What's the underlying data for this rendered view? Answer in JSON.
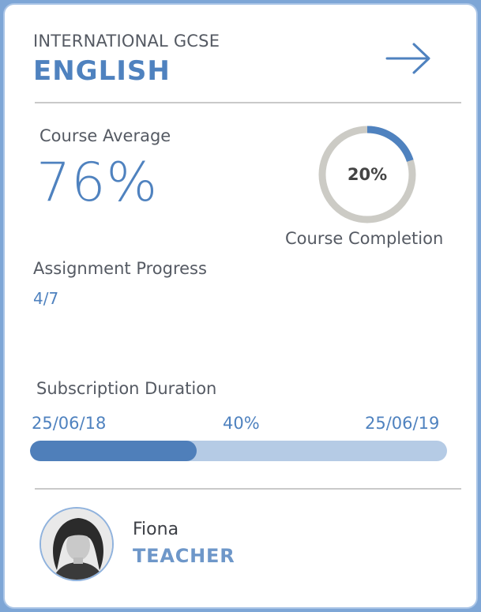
{
  "course": {
    "subtitle": "INTERNATIONAL GCSE",
    "title": "ENGLISH",
    "open_icon": "arrow-right-icon"
  },
  "stats": {
    "average_label": "Course Average",
    "average_value": "76%",
    "completion_label": "Course Completion",
    "completion_value": "20%",
    "completion_fraction": 0.2,
    "assignment_label": "Assignment Progress",
    "assignment_value": "4/7"
  },
  "subscription": {
    "label": "Subscription Duration",
    "start_date": "25/06/18",
    "percent_label": "40%",
    "end_date": "25/06/19",
    "progress_fraction": 0.4
  },
  "teacher": {
    "name": "Fiona",
    "role": "TEACHER",
    "avatar_icon": "teacher-avatar"
  },
  "colors": {
    "accent": "#4f82bf",
    "track": "#b5cbe5",
    "ring_bg": "#cccbc5"
  }
}
